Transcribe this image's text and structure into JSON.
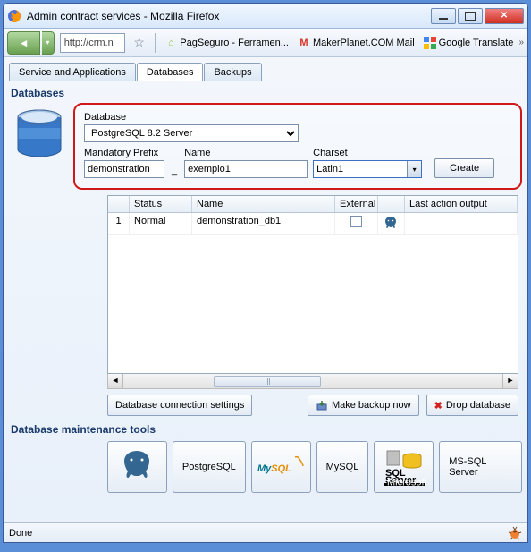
{
  "window": {
    "title": "Admin contract services - Mozilla Firefox"
  },
  "nav": {
    "url": "http://crm.n"
  },
  "bookmarks": [
    {
      "label": "PagSeguro - Ferramen...",
      "icon": "pagseguro",
      "color": "#8cc63f"
    },
    {
      "label": "MakerPlanet.COM Mail",
      "icon": "mail",
      "color": "#d93025"
    },
    {
      "label": "Google Translate",
      "icon": "google",
      "color": "#4285f4"
    }
  ],
  "tabs": [
    {
      "label": "Service and Applications",
      "active": false
    },
    {
      "label": "Databases",
      "active": true
    },
    {
      "label": "Backups",
      "active": false
    }
  ],
  "section_title": "Databases",
  "form": {
    "db_label": "Database",
    "db_value": "PostgreSQL 8.2 Server",
    "prefix_label": "Mandatory Prefix",
    "prefix_value": "demonstration",
    "name_label": "Name",
    "name_value": "exemplo1",
    "charset_label": "Charset",
    "charset_value": "Latin1",
    "create_label": "Create"
  },
  "grid": {
    "headers": {
      "status": "Status",
      "name": "Name",
      "external": "External",
      "last": "Last action output"
    },
    "rows": [
      {
        "idx": "1",
        "status": "Normal",
        "name": "demonstration_db1",
        "external": false
      }
    ]
  },
  "actions": {
    "conn": "Database connection settings",
    "backup": "Make backup now",
    "drop": "Drop database"
  },
  "maint": {
    "title": "Database maintenance tools",
    "tools": [
      {
        "label": "PostgreSQL"
      },
      {
        "label": "MySQL"
      },
      {
        "label": "MS-SQL Server"
      }
    ]
  },
  "status": {
    "text": "Done"
  }
}
